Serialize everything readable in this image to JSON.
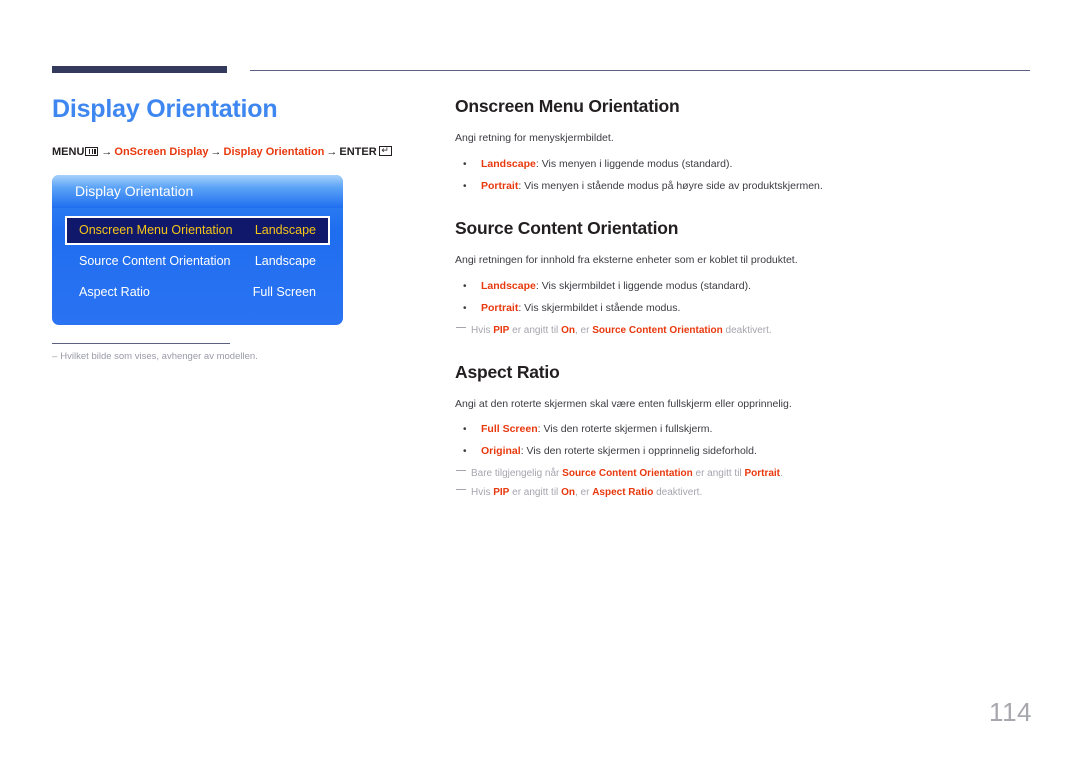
{
  "header": {
    "rule_color_thick": "#333a5c",
    "rule_color_thin": "#5b5f80"
  },
  "left": {
    "page_title": "Display Orientation",
    "breadcrumb": {
      "menu_label": "MENU",
      "menu_icon": "menu-bars-icon",
      "arrow": "→",
      "path_1": "OnScreen Display",
      "path_2": "Display Orientation",
      "enter_label": "ENTER",
      "enter_icon": "enter-return-icon",
      "enter_glyph": "↵",
      "accent_color": "#e8380d"
    },
    "osd": {
      "title": "Display Orientation",
      "rows": [
        {
          "label": "Onscreen Menu Orientation",
          "value": "Landscape",
          "selected": true
        },
        {
          "label": "Source Content Orientation",
          "value": "Landscape",
          "selected": false
        },
        {
          "label": "Aspect Ratio",
          "value": "Full Screen",
          "selected": false
        }
      ],
      "highlight_bg": "#10186b",
      "highlight_text": "#f5c518"
    },
    "footnote": {
      "dash": "–",
      "text": "Hvilket bilde som vises, avhenger av modellen."
    }
  },
  "right": {
    "sections": [
      {
        "title": "Onscreen Menu Orientation",
        "intro": "Angi retning for menyskjermbildet.",
        "bullets": [
          {
            "term": "Landscape",
            "rest": ": Vis menyen i liggende modus (standard)."
          },
          {
            "term": "Portrait",
            "rest": ": Vis menyen i stående modus på høyre side av produktskjermen."
          }
        ],
        "notes": []
      },
      {
        "title": "Source Content Orientation",
        "intro": "Angi retningen for innhold fra eksterne enheter som er koblet til produktet.",
        "bullets": [
          {
            "term": "Landscape",
            "rest": ": Vis skjermbildet i liggende modus (standard)."
          },
          {
            "term": "Portrait",
            "rest": ": Vis skjermbildet i stående modus."
          }
        ],
        "notes": [
          {
            "parts": [
              {
                "text": "Hvis ",
                "em": false
              },
              {
                "text": "PIP",
                "em": true
              },
              {
                "text": " er angitt til ",
                "em": false
              },
              {
                "text": "On",
                "em": true
              },
              {
                "text": ", er ",
                "em": false
              },
              {
                "text": "Source Content Orientation",
                "em": true
              },
              {
                "text": " deaktivert.",
                "em": false
              }
            ]
          }
        ]
      },
      {
        "title": "Aspect Ratio",
        "intro": "Angi at den roterte skjermen skal være enten fullskjerm eller opprinnelig.",
        "bullets": [
          {
            "term": "Full Screen",
            "rest": ": Vis den roterte skjermen i fullskjerm."
          },
          {
            "term": "Original",
            "rest": ": Vis den roterte skjermen i opprinnelig sideforhold."
          }
        ],
        "notes": [
          {
            "parts": [
              {
                "text": "Bare tilgjengelig når ",
                "em": false
              },
              {
                "text": "Source Content Orientation",
                "em": true
              },
              {
                "text": " er angitt til ",
                "em": false
              },
              {
                "text": "Portrait",
                "em": true
              },
              {
                "text": ".",
                "em": false
              }
            ]
          },
          {
            "parts": [
              {
                "text": "Hvis ",
                "em": false
              },
              {
                "text": "PIP",
                "em": true
              },
              {
                "text": " er angitt til ",
                "em": false
              },
              {
                "text": "On",
                "em": true
              },
              {
                "text": ", er ",
                "em": false
              },
              {
                "text": "Aspect Ratio",
                "em": true
              },
              {
                "text": " deaktivert.",
                "em": false
              }
            ]
          }
        ]
      }
    ]
  },
  "page_number": "114"
}
